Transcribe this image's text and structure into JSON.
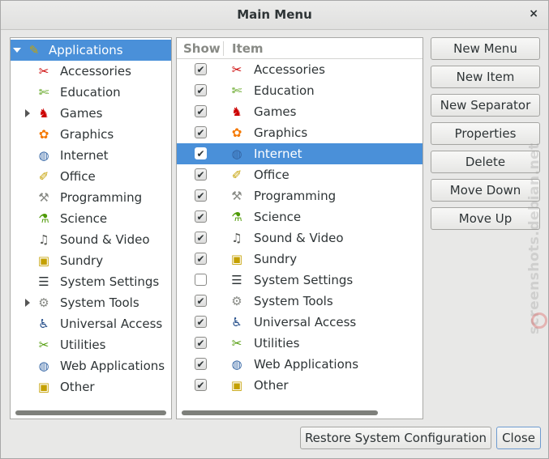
{
  "window": {
    "title": "Main Menu",
    "close_glyph": "×"
  },
  "tree": {
    "items": [
      {
        "label": "Applications",
        "icon": "applications-icon",
        "glyph": "✎",
        "color": "#c7a300",
        "selected": true,
        "expanded": true
      },
      {
        "label": "Accessories",
        "icon": "accessories-icon",
        "glyph": "✂",
        "color": "#cc0000"
      },
      {
        "label": "Education",
        "icon": "education-icon",
        "glyph": "✄",
        "color": "#4e9a06"
      },
      {
        "label": "Games",
        "icon": "games-icon",
        "glyph": "♞",
        "color": "#cc0000",
        "collapsed": true
      },
      {
        "label": "Graphics",
        "icon": "graphics-icon",
        "glyph": "✿",
        "color": "#f57900"
      },
      {
        "label": "Internet",
        "icon": "internet-icon",
        "glyph": "◍",
        "color": "#3465a4"
      },
      {
        "label": "Office",
        "icon": "office-icon",
        "glyph": "✐",
        "color": "#c4a000"
      },
      {
        "label": "Programming",
        "icon": "programming-icon",
        "glyph": "⚒",
        "color": "#888a85"
      },
      {
        "label": "Science",
        "icon": "science-icon",
        "glyph": "⚗",
        "color": "#4e9a06"
      },
      {
        "label": "Sound & Video",
        "icon": "sound-video-icon",
        "glyph": "♫",
        "color": "#555753"
      },
      {
        "label": "Sundry",
        "icon": "sundry-icon",
        "glyph": "▣",
        "color": "#c4a000"
      },
      {
        "label": "System Settings",
        "icon": "system-settings-icon",
        "glyph": "☰",
        "color": "#2e3436"
      },
      {
        "label": "System Tools",
        "icon": "system-tools-icon",
        "glyph": "⚙",
        "color": "#888a85",
        "collapsed": true
      },
      {
        "label": "Universal Access",
        "icon": "universal-access-icon",
        "glyph": "♿",
        "color": "#204a87"
      },
      {
        "label": "Utilities",
        "icon": "utilities-icon",
        "glyph": "✂",
        "color": "#4e9a06"
      },
      {
        "label": "Web Applications",
        "icon": "web-applications-icon",
        "glyph": "◍",
        "color": "#3465a4"
      },
      {
        "label": "Other",
        "icon": "other-icon",
        "glyph": "▣",
        "color": "#c4a000"
      }
    ]
  },
  "list": {
    "col_show": "Show",
    "col_item": "Item",
    "items": [
      {
        "label": "Accessories",
        "shown": true,
        "icon": "accessories-icon",
        "glyph": "✂",
        "color": "#cc0000"
      },
      {
        "label": "Education",
        "shown": true,
        "icon": "education-icon",
        "glyph": "✄",
        "color": "#4e9a06"
      },
      {
        "label": "Games",
        "shown": true,
        "icon": "games-icon",
        "glyph": "♞",
        "color": "#cc0000"
      },
      {
        "label": "Graphics",
        "shown": true,
        "icon": "graphics-icon",
        "glyph": "✿",
        "color": "#f57900"
      },
      {
        "label": "Internet",
        "shown": true,
        "icon": "internet-icon",
        "glyph": "◍",
        "color": "#3465a4",
        "selected": true
      },
      {
        "label": "Office",
        "shown": true,
        "icon": "office-icon",
        "glyph": "✐",
        "color": "#c4a000"
      },
      {
        "label": "Programming",
        "shown": true,
        "icon": "programming-icon",
        "glyph": "⚒",
        "color": "#888a85"
      },
      {
        "label": "Science",
        "shown": true,
        "icon": "science-icon",
        "glyph": "⚗",
        "color": "#4e9a06"
      },
      {
        "label": "Sound & Video",
        "shown": true,
        "icon": "sound-video-icon",
        "glyph": "♫",
        "color": "#555753"
      },
      {
        "label": "Sundry",
        "shown": true,
        "icon": "sundry-icon",
        "glyph": "▣",
        "color": "#c4a000"
      },
      {
        "label": "System Settings",
        "shown": false,
        "icon": "system-settings-icon",
        "glyph": "☰",
        "color": "#2e3436"
      },
      {
        "label": "System Tools",
        "shown": true,
        "icon": "system-tools-icon",
        "glyph": "⚙",
        "color": "#888a85"
      },
      {
        "label": "Universal Access",
        "shown": true,
        "icon": "universal-access-icon",
        "glyph": "♿",
        "color": "#204a87"
      },
      {
        "label": "Utilities",
        "shown": true,
        "icon": "utilities-icon",
        "glyph": "✂",
        "color": "#4e9a06"
      },
      {
        "label": "Web Applications",
        "shown": true,
        "icon": "web-applications-icon",
        "glyph": "◍",
        "color": "#3465a4"
      },
      {
        "label": "Other",
        "shown": true,
        "icon": "other-icon",
        "glyph": "▣",
        "color": "#c4a000"
      }
    ]
  },
  "buttons": {
    "new_menu": "New Menu",
    "new_item": "New Item",
    "new_separator": "New Separator",
    "properties": "Properties",
    "delete": "Delete",
    "move_down": "Move Down",
    "move_up": "Move Up",
    "restore": "Restore System Configuration",
    "close": "Close"
  },
  "watermark": "screenshots.debian.net",
  "colors": {
    "selection": "#4a90d9",
    "window_bg": "#e8e8e7"
  }
}
